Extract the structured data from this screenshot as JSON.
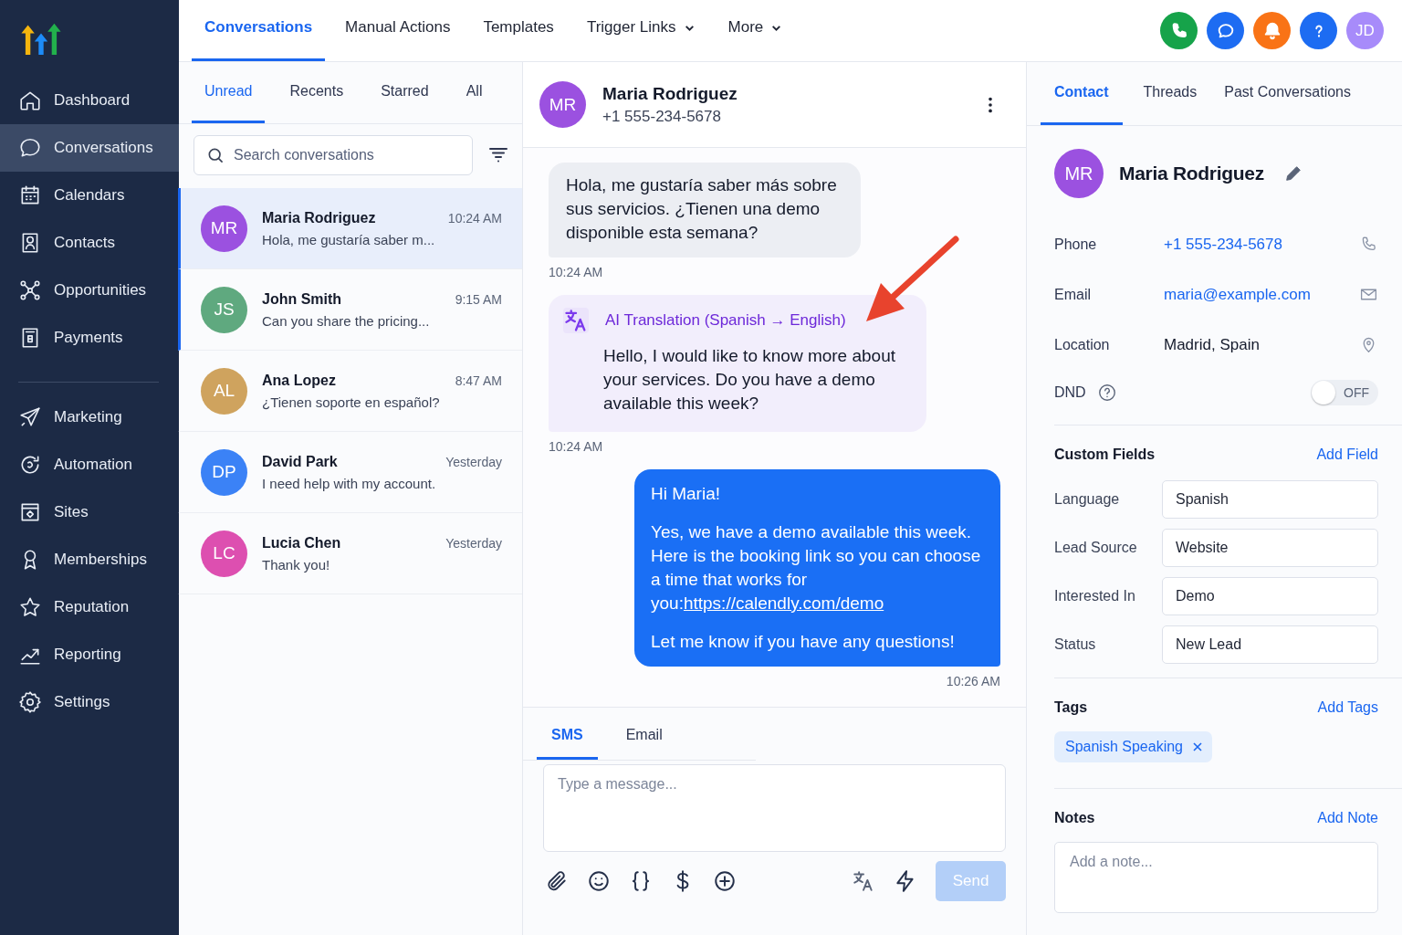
{
  "sidebar": {
    "sections": [
      {
        "items": [
          {
            "label": "Dashboard",
            "selected": false
          },
          {
            "label": "Conversations",
            "selected": true
          },
          {
            "label": "Calendars",
            "selected": false
          },
          {
            "label": "Contacts",
            "selected": false
          },
          {
            "label": "Opportunities",
            "selected": false
          },
          {
            "label": "Payments",
            "selected": false
          }
        ]
      },
      {
        "items": [
          {
            "label": "Marketing",
            "selected": false
          },
          {
            "label": "Automation",
            "selected": false
          },
          {
            "label": "Sites",
            "selected": false
          },
          {
            "label": "Memberships",
            "selected": false
          },
          {
            "label": "Reputation",
            "selected": false
          },
          {
            "label": "Reporting",
            "selected": false
          },
          {
            "label": "Settings",
            "selected": false
          }
        ]
      }
    ]
  },
  "top_nav": {
    "tabs": [
      {
        "label": "Conversations",
        "selected": true,
        "has_menu": false
      },
      {
        "label": "Manual Actions",
        "selected": false,
        "has_menu": false
      },
      {
        "label": "Templates",
        "selected": false,
        "has_menu": false
      },
      {
        "label": "Trigger Links",
        "selected": false,
        "has_menu": true
      },
      {
        "label": "More",
        "selected": false,
        "has_menu": true
      }
    ],
    "actions": [
      {
        "kind": "phone",
        "color": "#16a34a"
      },
      {
        "kind": "chat",
        "color": "#1d6cf2"
      },
      {
        "kind": "bell",
        "color": "#f97316"
      },
      {
        "kind": "help",
        "color": "#1d6cf2"
      }
    ],
    "avatar": {
      "initials": "JD",
      "color": "#a78bfa"
    }
  },
  "conversation_list": {
    "tabs": [
      {
        "label": "Unread",
        "selected": true
      },
      {
        "label": "Recents",
        "selected": false
      },
      {
        "label": "Starred",
        "selected": false
      },
      {
        "label": "All",
        "selected": false
      }
    ],
    "search": {
      "placeholder": "Search conversations"
    },
    "conversations": [
      {
        "initials": "MR",
        "color": "#9b51e0",
        "name": "Maria Rodriguez",
        "time": "10:24 AM",
        "preview": "Hola, me gustaría saber m...",
        "selected": true,
        "unread": true
      },
      {
        "initials": "JS",
        "color": "#5fa97f",
        "name": "John Smith",
        "time": "9:15 AM",
        "preview": "Can you share the pricing...",
        "selected": false,
        "unread": true
      },
      {
        "initials": "AL",
        "color": "#cfa35e",
        "name": "Ana Lopez",
        "time": "8:47 AM",
        "preview": "¿Tienen soporte en español?",
        "selected": false,
        "unread": false
      },
      {
        "initials": "DP",
        "color": "#3b82f6",
        "name": "David Park",
        "time": "Yesterday",
        "preview": "I need help with my account.",
        "selected": false,
        "unread": false
      },
      {
        "initials": "LC",
        "color": "#dd4fb0",
        "name": "Lucia Chen",
        "time": "Yesterday",
        "preview": "Thank you!",
        "selected": false,
        "unread": false
      }
    ]
  },
  "chat": {
    "header": {
      "initials": "MR",
      "color": "#9b51e0",
      "name": "Maria Rodriguez",
      "phone": "+1 555-234-5678"
    },
    "messages": [
      {
        "kind": "incoming",
        "text": "Hola, me gustaría saber más sobre sus servicios. ¿Tienen una demo disponible esta semana?",
        "time": "10:24 AM"
      },
      {
        "kind": "translation",
        "label": "AI Translation (Spanish → English)",
        "text": "Hello, I would like to know more about your services. Do you have a demo available this week?",
        "time": "10:24 AM"
      },
      {
        "kind": "outgoing",
        "paragraphs": [
          {
            "text": "Hi Maria!"
          },
          {
            "text": "Yes, we have a demo available this week. Here is the booking link so you can choose a time that works for you:",
            "link": "https://calendly.com/demo"
          },
          {
            "text": "Let me know if you have any questions!"
          }
        ],
        "time": "10:26 AM"
      }
    ],
    "composer": {
      "tabs": [
        {
          "label": "SMS",
          "selected": true
        },
        {
          "label": "Email",
          "selected": false
        }
      ],
      "placeholder": "Type a message...",
      "send": {
        "label": "Send",
        "disabled": true
      }
    }
  },
  "contact_panel": {
    "tabs": [
      {
        "label": "Contact",
        "selected": true
      },
      {
        "label": "Threads",
        "selected": false
      },
      {
        "label": "Past Conversations",
        "selected": false
      }
    ],
    "contact": {
      "initials": "MR",
      "color": "#9b51e0",
      "name": "Maria Rodriguez"
    },
    "details": [
      {
        "kind": "phone",
        "label": "Phone",
        "value": "+1 555-234-5678"
      },
      {
        "kind": "email",
        "label": "Email",
        "value": "maria@example.com"
      },
      {
        "kind": "location",
        "label": "Location",
        "value": "Madrid, Spain"
      }
    ],
    "dnd": {
      "label": "DND",
      "on": false,
      "state_label": "OFF"
    },
    "custom_fields": {
      "title": "Custom Fields",
      "action": "Add Field",
      "fields": [
        {
          "label": "Language",
          "value": "Spanish"
        },
        {
          "label": "Lead Source",
          "value": "Website"
        },
        {
          "label": "Interested In",
          "value": "Demo"
        },
        {
          "label": "Status",
          "value": "New Lead"
        }
      ]
    },
    "tags": {
      "title": "Tags",
      "action": "Add Tags",
      "items": [
        {
          "label": "Spanish Speaking"
        }
      ]
    },
    "notes": {
      "title": "Notes",
      "action": "Add Note",
      "placeholder": "Add a note..."
    }
  }
}
